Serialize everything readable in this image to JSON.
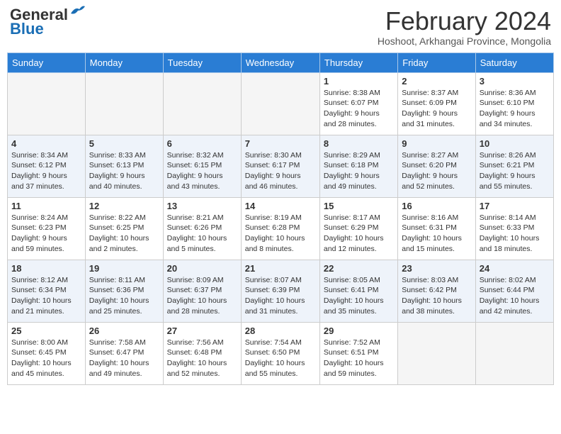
{
  "logo": {
    "line1": "General",
    "line2": "Blue"
  },
  "title": "February 2024",
  "location": "Hoshoot, Arkhangai Province, Mongolia",
  "headers": [
    "Sunday",
    "Monday",
    "Tuesday",
    "Wednesday",
    "Thursday",
    "Friday",
    "Saturday"
  ],
  "weeks": [
    [
      {
        "day": "",
        "info": ""
      },
      {
        "day": "",
        "info": ""
      },
      {
        "day": "",
        "info": ""
      },
      {
        "day": "",
        "info": ""
      },
      {
        "day": "1",
        "info": "Sunrise: 8:38 AM\nSunset: 6:07 PM\nDaylight: 9 hours\nand 28 minutes."
      },
      {
        "day": "2",
        "info": "Sunrise: 8:37 AM\nSunset: 6:09 PM\nDaylight: 9 hours\nand 31 minutes."
      },
      {
        "day": "3",
        "info": "Sunrise: 8:36 AM\nSunset: 6:10 PM\nDaylight: 9 hours\nand 34 minutes."
      }
    ],
    [
      {
        "day": "4",
        "info": "Sunrise: 8:34 AM\nSunset: 6:12 PM\nDaylight: 9 hours\nand 37 minutes."
      },
      {
        "day": "5",
        "info": "Sunrise: 8:33 AM\nSunset: 6:13 PM\nDaylight: 9 hours\nand 40 minutes."
      },
      {
        "day": "6",
        "info": "Sunrise: 8:32 AM\nSunset: 6:15 PM\nDaylight: 9 hours\nand 43 minutes."
      },
      {
        "day": "7",
        "info": "Sunrise: 8:30 AM\nSunset: 6:17 PM\nDaylight: 9 hours\nand 46 minutes."
      },
      {
        "day": "8",
        "info": "Sunrise: 8:29 AM\nSunset: 6:18 PM\nDaylight: 9 hours\nand 49 minutes."
      },
      {
        "day": "9",
        "info": "Sunrise: 8:27 AM\nSunset: 6:20 PM\nDaylight: 9 hours\nand 52 minutes."
      },
      {
        "day": "10",
        "info": "Sunrise: 8:26 AM\nSunset: 6:21 PM\nDaylight: 9 hours\nand 55 minutes."
      }
    ],
    [
      {
        "day": "11",
        "info": "Sunrise: 8:24 AM\nSunset: 6:23 PM\nDaylight: 9 hours\nand 59 minutes."
      },
      {
        "day": "12",
        "info": "Sunrise: 8:22 AM\nSunset: 6:25 PM\nDaylight: 10 hours\nand 2 minutes."
      },
      {
        "day": "13",
        "info": "Sunrise: 8:21 AM\nSunset: 6:26 PM\nDaylight: 10 hours\nand 5 minutes."
      },
      {
        "day": "14",
        "info": "Sunrise: 8:19 AM\nSunset: 6:28 PM\nDaylight: 10 hours\nand 8 minutes."
      },
      {
        "day": "15",
        "info": "Sunrise: 8:17 AM\nSunset: 6:29 PM\nDaylight: 10 hours\nand 12 minutes."
      },
      {
        "day": "16",
        "info": "Sunrise: 8:16 AM\nSunset: 6:31 PM\nDaylight: 10 hours\nand 15 minutes."
      },
      {
        "day": "17",
        "info": "Sunrise: 8:14 AM\nSunset: 6:33 PM\nDaylight: 10 hours\nand 18 minutes."
      }
    ],
    [
      {
        "day": "18",
        "info": "Sunrise: 8:12 AM\nSunset: 6:34 PM\nDaylight: 10 hours\nand 21 minutes."
      },
      {
        "day": "19",
        "info": "Sunrise: 8:11 AM\nSunset: 6:36 PM\nDaylight: 10 hours\nand 25 minutes."
      },
      {
        "day": "20",
        "info": "Sunrise: 8:09 AM\nSunset: 6:37 PM\nDaylight: 10 hours\nand 28 minutes."
      },
      {
        "day": "21",
        "info": "Sunrise: 8:07 AM\nSunset: 6:39 PM\nDaylight: 10 hours\nand 31 minutes."
      },
      {
        "day": "22",
        "info": "Sunrise: 8:05 AM\nSunset: 6:41 PM\nDaylight: 10 hours\nand 35 minutes."
      },
      {
        "day": "23",
        "info": "Sunrise: 8:03 AM\nSunset: 6:42 PM\nDaylight: 10 hours\nand 38 minutes."
      },
      {
        "day": "24",
        "info": "Sunrise: 8:02 AM\nSunset: 6:44 PM\nDaylight: 10 hours\nand 42 minutes."
      }
    ],
    [
      {
        "day": "25",
        "info": "Sunrise: 8:00 AM\nSunset: 6:45 PM\nDaylight: 10 hours\nand 45 minutes."
      },
      {
        "day": "26",
        "info": "Sunrise: 7:58 AM\nSunset: 6:47 PM\nDaylight: 10 hours\nand 49 minutes."
      },
      {
        "day": "27",
        "info": "Sunrise: 7:56 AM\nSunset: 6:48 PM\nDaylight: 10 hours\nand 52 minutes."
      },
      {
        "day": "28",
        "info": "Sunrise: 7:54 AM\nSunset: 6:50 PM\nDaylight: 10 hours\nand 55 minutes."
      },
      {
        "day": "29",
        "info": "Sunrise: 7:52 AM\nSunset: 6:51 PM\nDaylight: 10 hours\nand 59 minutes."
      },
      {
        "day": "",
        "info": ""
      },
      {
        "day": "",
        "info": ""
      }
    ]
  ]
}
